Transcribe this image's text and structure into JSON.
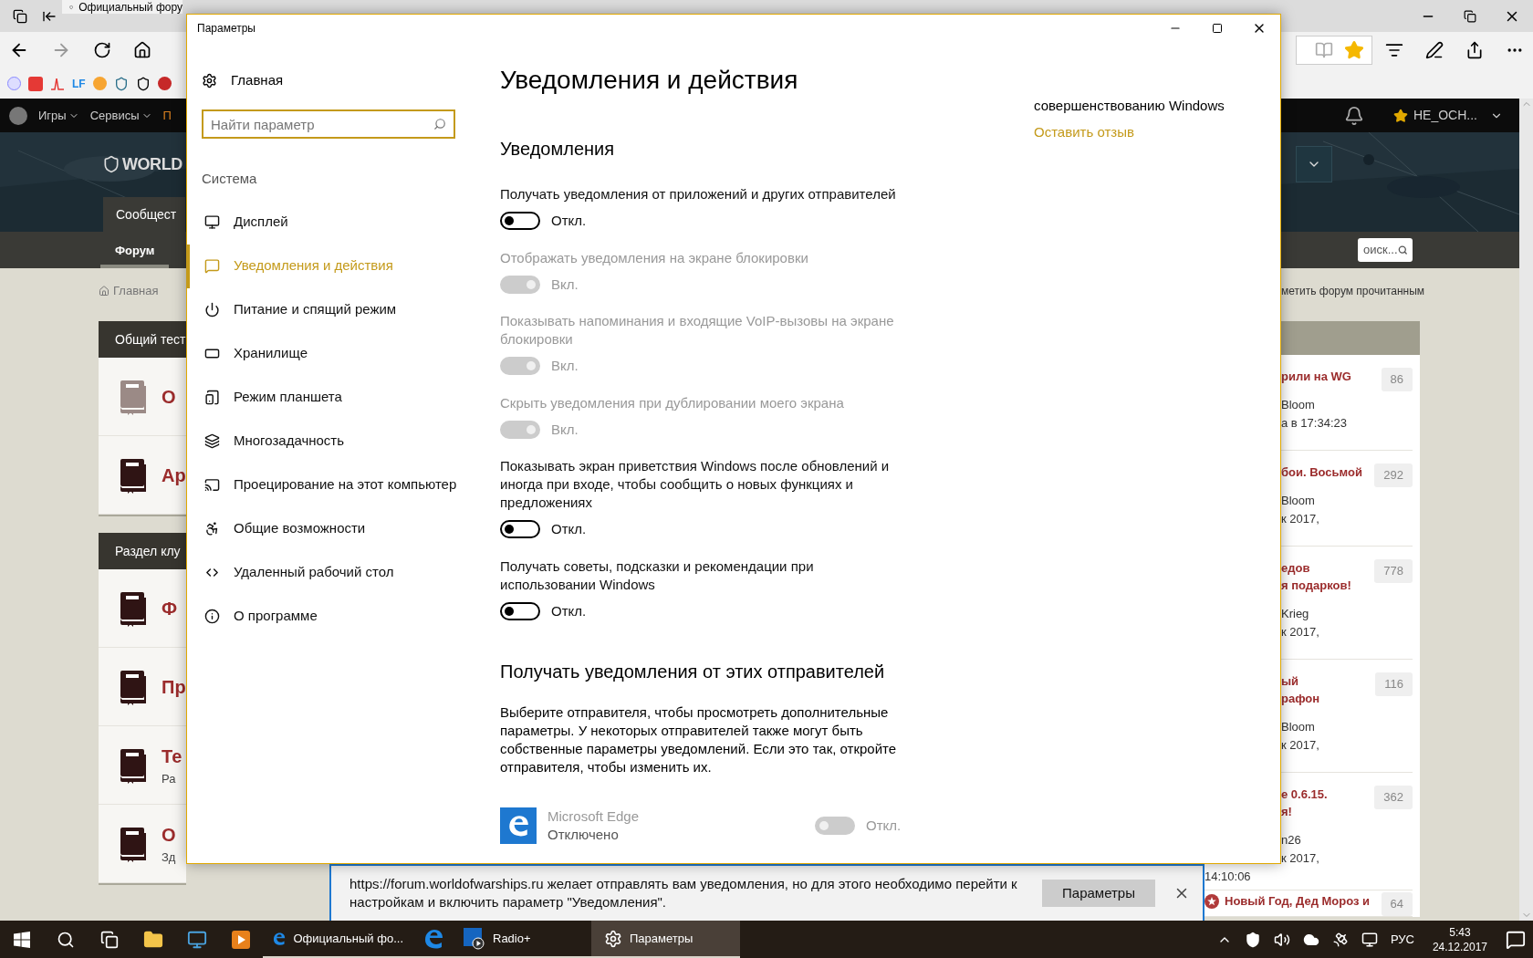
{
  "browser": {
    "tabs": [
      {
        "title": "Официальный фору",
        "selected": true
      }
    ],
    "favicon_text": "LF"
  },
  "forum": {
    "nav": [
      "Игры",
      "Сервисы",
      "П"
    ],
    "user": "НЕ_ОСН...",
    "logo": "WORLD",
    "tab": "Сообщест",
    "subtab": "Форум",
    "breadcrumb": "Главная",
    "search": {
      "value": "оиск..."
    },
    "mark_read": "метить форум прочитанным",
    "left_sections": [
      {
        "title": "Общий тест",
        "rows": [
          {
            "title": "О",
            "unread": false
          },
          {
            "title": "Ар",
            "unread": true
          }
        ]
      },
      {
        "title": "Раздел клу",
        "rows": [
          {
            "title": "Ф",
            "unread": true
          },
          {
            "title": "Пр",
            "unread": true
          },
          {
            "title": "Те",
            "sub": "Ра",
            "unread": true
          },
          {
            "title": "О",
            "sub": "Зд",
            "unread": true
          }
        ]
      }
    ],
    "topics": [
      {
        "title_lines": [
          "рили на WG"
        ],
        "author": "Bloom",
        "date": "а в 17:34:23",
        "count": "86"
      },
      {
        "title_lines": [
          "бои. Восьмой"
        ],
        "author": "Bloom",
        "date": "к 2017,",
        "count": "292"
      },
      {
        "title_lines": [
          "едов",
          "я подарков!"
        ],
        "author": "Krieg",
        "date": "к 2017,",
        "count": "778"
      },
      {
        "title_lines": [
          "ый",
          "рафон"
        ],
        "author": "Bloom",
        "date": "к 2017,",
        "count": "116"
      },
      {
        "title_lines": [
          "е 0.6.15.",
          "я!"
        ],
        "author": "n26",
        "date": "к 2017,",
        "time": "14:10:06",
        "count": "362"
      },
      {
        "title_lines": [
          "Новый Год, Дед Мороз и"
        ],
        "count": "64",
        "pinned": true
      }
    ]
  },
  "settings": {
    "title": "Параметры",
    "home": "Главная",
    "search_placeholder": "Найти параметр",
    "group": "Система",
    "nav": [
      {
        "label": "Дисплей",
        "selected": false
      },
      {
        "label": "Уведомления и действия",
        "selected": true
      },
      {
        "label": "Питание и спящий режим",
        "selected": false
      },
      {
        "label": "Хранилище",
        "selected": false
      },
      {
        "label": "Режим планшета",
        "selected": false
      },
      {
        "label": "Многозадачность",
        "selected": false
      },
      {
        "label": "Проецирование на этот компьютер",
        "selected": false
      },
      {
        "label": "Общие возможности",
        "selected": false
      },
      {
        "label": "Удаленный рабочий стол",
        "selected": false
      },
      {
        "label": "О программе",
        "selected": false
      }
    ],
    "page_title": "Уведомления и действия",
    "section_title": "Уведомления",
    "toggles": [
      {
        "label": "Получать уведомления от приложений и других отправителей",
        "state": "Откл.",
        "on": false,
        "disabled": false
      },
      {
        "label": "Отображать уведомления на экране блокировки",
        "state": "Вкл.",
        "on": true,
        "disabled": true
      },
      {
        "label": "Показывать напоминания и входящие VoIP-вызовы на экране блокировки",
        "state": "Вкл.",
        "on": true,
        "disabled": true
      },
      {
        "label": "Скрыть уведомления при дублировании моего экрана",
        "state": "Вкл.",
        "on": true,
        "disabled": true
      },
      {
        "label": "Показывать экран приветствия Windows после обновлений и иногда при входе, чтобы сообщить о новых функциях и предложениях",
        "state": "Откл.",
        "on": false,
        "disabled": false
      },
      {
        "label": "Получать советы, подсказки и рекомендации при использовании Windows",
        "state": "Откл.",
        "on": false,
        "disabled": false
      }
    ],
    "senders_title": "Получать уведомления от этих отправителей",
    "senders_text": "Выберите отправителя, чтобы просмотреть дополнительные параметры. У некоторых отправителей также могут быть собственные параметры уведомлений. Если это так, откройте отправителя, чтобы изменить их.",
    "senders": [
      {
        "name": "Microsoft Edge",
        "status": "Отключено",
        "state": "Откл.",
        "on": false,
        "disabled": true
      }
    ],
    "side_text": "совершенствованию Windows",
    "feedback_link": "Оставить отзыв"
  },
  "notification": {
    "text": "https://forum.worldofwarships.ru желает отправлять вам уведомления, но для этого необходимо перейти к настройкам и включить параметр \"Уведомления\".",
    "button": "Параметры"
  },
  "taskbar": {
    "items": [
      {
        "kind": "start",
        "open": false,
        "selected": false
      },
      {
        "kind": "search",
        "open": false,
        "selected": false
      },
      {
        "kind": "taskview",
        "open": false,
        "selected": false
      },
      {
        "kind": "folder",
        "open": false,
        "selected": false
      },
      {
        "kind": "app",
        "open": false,
        "selected": false
      },
      {
        "kind": "media",
        "open": false,
        "selected": false
      },
      {
        "kind": "edge",
        "label": "Официальный фо...",
        "open": true,
        "selected": false
      },
      {
        "kind": "ie",
        "open": true,
        "selected": false
      },
      {
        "kind": "radio",
        "label": "Radio+",
        "open": true,
        "selected": false
      },
      {
        "kind": "settings",
        "label": "Параметры",
        "open": true,
        "selected": true
      }
    ],
    "language": "РУС",
    "time": "5:43",
    "date": "24.12.2017"
  }
}
